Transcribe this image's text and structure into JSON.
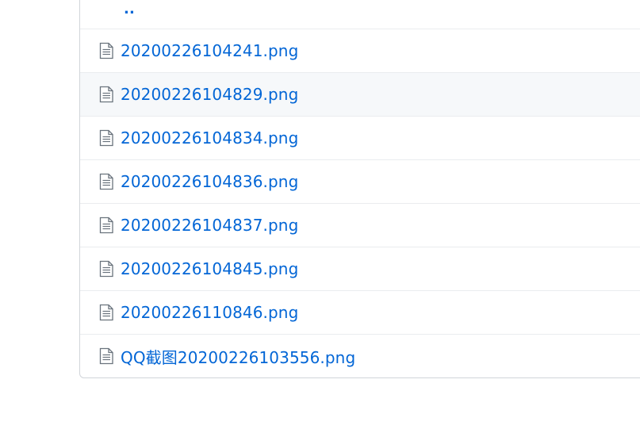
{
  "file_list": {
    "parent_link": "..",
    "files": [
      {
        "name": "20200226104241.png",
        "icon": "file-icon"
      },
      {
        "name": "20200226104829.png",
        "icon": "file-icon"
      },
      {
        "name": "20200226104834.png",
        "icon": "file-icon"
      },
      {
        "name": "20200226104836.png",
        "icon": "file-icon"
      },
      {
        "name": "20200226104837.png",
        "icon": "file-icon"
      },
      {
        "name": "20200226104845.png",
        "icon": "file-icon"
      },
      {
        "name": "20200226110846.png",
        "icon": "file-icon"
      },
      {
        "name": "QQ截图20200226103556.png",
        "icon": "file-icon"
      }
    ]
  },
  "colors": {
    "link": "#0366d6",
    "border": "#d1d5da",
    "row_divider": "#eaecef",
    "hover_bg": "#f6f8fa",
    "icon": "#6a737d"
  }
}
